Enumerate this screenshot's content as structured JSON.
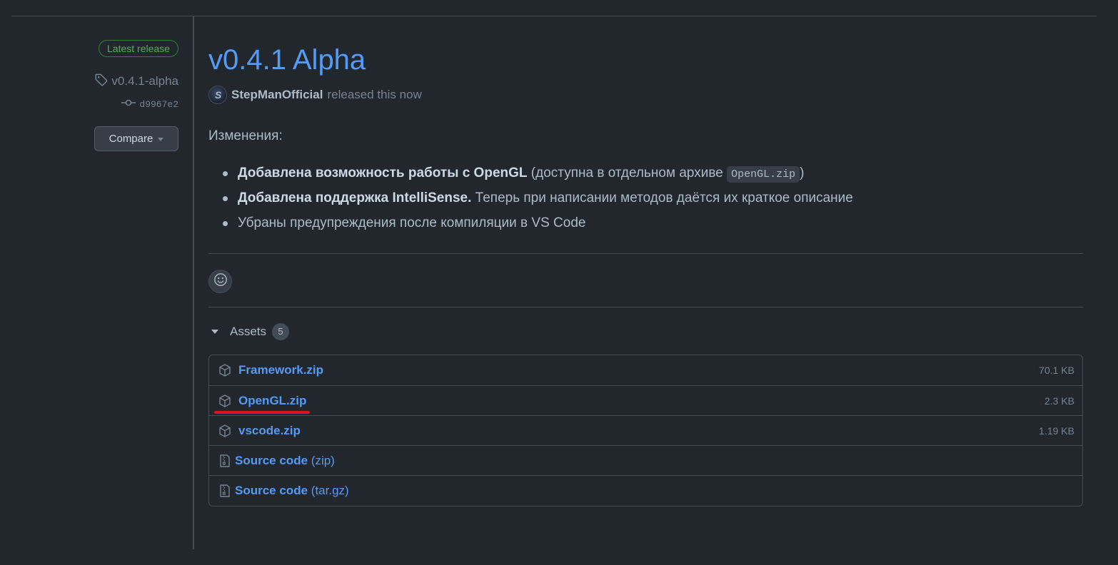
{
  "sidebar": {
    "badge": "Latest release",
    "tag": "v0.4.1-alpha",
    "commit": "d9967e2",
    "compare_label": "Compare"
  },
  "release": {
    "title": "v0.4.1 Alpha",
    "author": "StepManOfficial",
    "released_text": "released this now",
    "changes_heading": "Изменения:",
    "changes": [
      {
        "bold": "Добавлена возможность работы с OpenGL",
        "pre": " (доступна в отдельном архиве ",
        "code": "OpenGL.zip",
        "post": ")"
      },
      {
        "bold": "Добавлена поддержка IntelliSense.",
        "text": " Теперь при написании методов даётся их краткое описание"
      },
      {
        "text": "Убраны предупреждения после компиляции в VS Code"
      }
    ]
  },
  "assets": {
    "label": "Assets",
    "count": "5",
    "items": [
      {
        "name": "Framework.zip",
        "size": "70.1 KB",
        "icon": "package-icon"
      },
      {
        "name": "OpenGL.zip",
        "size": "2.3 KB",
        "icon": "package-icon",
        "highlighted": true
      },
      {
        "name": "vscode.zip",
        "size": "1.19 KB",
        "icon": "package-icon"
      },
      {
        "name": "Source code",
        "suffix": "(zip)",
        "icon": "file-zip-icon"
      },
      {
        "name": "Source code",
        "suffix": "(tar.gz)",
        "icon": "file-zip-icon"
      }
    ]
  },
  "colors": {
    "background": "#22272e",
    "link": "#539bf5",
    "badge_green": "#57ab5a",
    "highlight_underline": "#e0131b"
  }
}
